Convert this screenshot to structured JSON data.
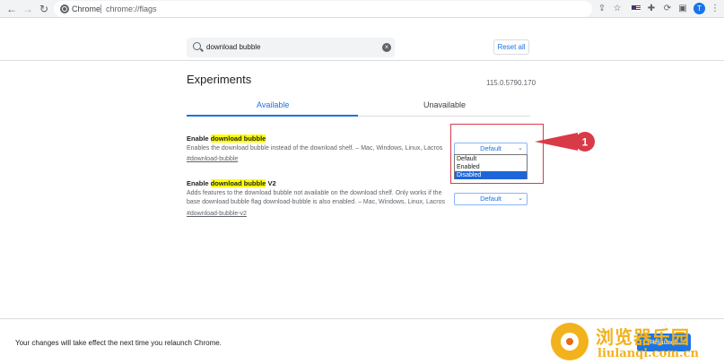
{
  "browser": {
    "site_name": "Chrome",
    "url": "chrome://flags",
    "profile_initial": "T"
  },
  "header": {
    "search_value": "download bubble",
    "reset_label": "Reset all"
  },
  "main": {
    "title": "Experiments",
    "version": "115.0.5790.170",
    "tabs": [
      {
        "label": "Available",
        "active": true
      },
      {
        "label": "Unavailable",
        "active": false
      }
    ],
    "experiments": [
      {
        "title_prefix": "Enable ",
        "title_highlight": "download bubble",
        "title_suffix": "",
        "description": "Enables the download bubble instead of the download shelf. – Mac, Windows, Linux, Lacros",
        "link": "#download-bubble",
        "select_value": "Default",
        "options": [
          "Default",
          "Enabled",
          "Disabled"
        ],
        "highlighted_option": "Disabled"
      },
      {
        "title_prefix": "Enable ",
        "title_highlight": "download bubble",
        "title_suffix": " V2",
        "description": "Adds features to the download bubble not available on the download shelf. Only works if the base download bubble flag download-bubble is also enabled. – Mac, Windows, Linux, Lacros",
        "link": "#download-bubble-v2",
        "select_value": "Default"
      }
    ]
  },
  "annotation": {
    "number": "1",
    "color": "#d93a48"
  },
  "footer": {
    "message": "Your changes will take effect the next time you relaunch Chrome.",
    "relaunch_label": "Relaunch"
  },
  "watermark": {
    "name": "浏览器乐园",
    "url": "liulanqi.com.cn"
  },
  "colors": {
    "accent": "#1a73e8",
    "highlight": "#ffff00",
    "watermark": "#f2b21c"
  }
}
